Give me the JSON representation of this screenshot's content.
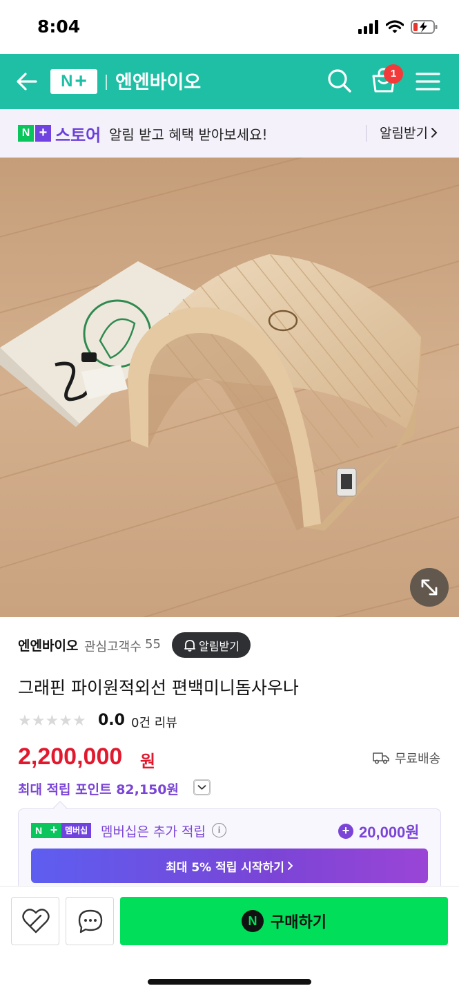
{
  "status_bar": {
    "time": "8:04"
  },
  "header": {
    "logo_n": "N",
    "logo_plus": "+",
    "store_name": "엔엔바이오",
    "cart_count": "1"
  },
  "notice": {
    "logo_n": "N",
    "logo_plus": "+",
    "brand": "스토어",
    "text": "알림 받고 혜택 받아보세요!",
    "action": "알림받기"
  },
  "gallery": {
    "image_count": 5,
    "active_index": 0
  },
  "product": {
    "seller": "엔엔바이오",
    "followers_label": "관심고객수",
    "followers_count": "55",
    "alarm_button": "알림받기",
    "title": "그래핀 파이원적외선 편백미니돔사우나",
    "rating": "0.0",
    "review_count": "0건 리뷰",
    "price": "2,200,000",
    "price_unit": "원",
    "shipping": "무료배송",
    "points": "최대 적립 포인트 82,150원"
  },
  "membership": {
    "logo_n": "N",
    "logo_plus": "+",
    "logo_label": "멤버십",
    "text": "멤버십은 추가 적립",
    "info": "i",
    "plus": "+",
    "amount": "20,000원",
    "cta": "최대 5% 적립 시작하기"
  },
  "bottom_bar": {
    "buy_icon": "N",
    "buy_label": "구매하기"
  },
  "colors": {
    "header": "#1ebfa5",
    "price": "#e1192f",
    "accent_purple": "#7a45d6",
    "buy_green": "#00de5a"
  }
}
